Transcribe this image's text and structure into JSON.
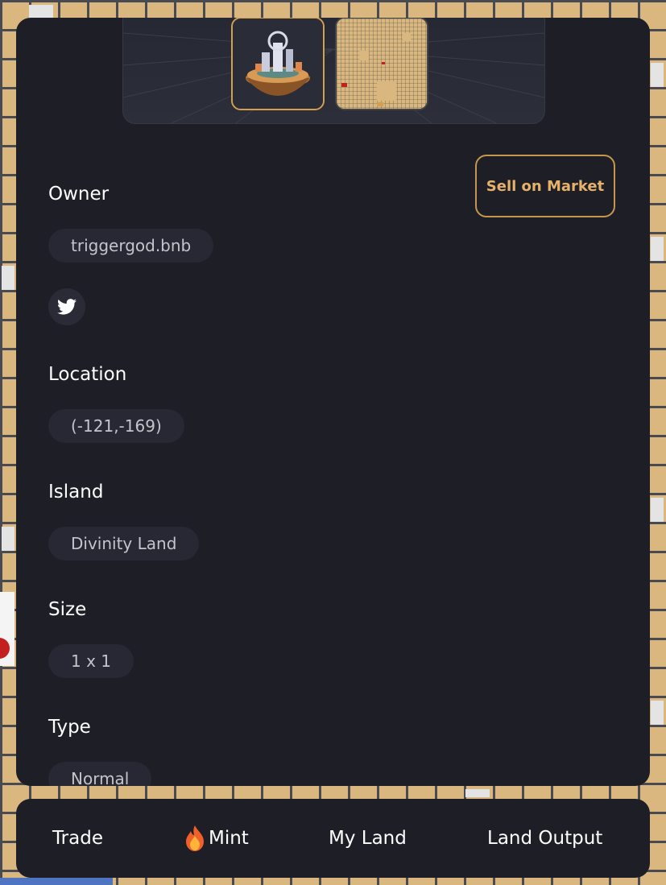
{
  "actions": {
    "sell_label": "Sell on Market"
  },
  "details": {
    "owner": {
      "label": "Owner",
      "value": "triggergod.bnb"
    },
    "location": {
      "label": "Location",
      "value": "(-121,-169)"
    },
    "island": {
      "label": "Island",
      "value": "Divinity Land"
    },
    "size": {
      "label": "Size",
      "value": "1 x 1"
    },
    "type": {
      "label": "Type",
      "value": "Normal"
    }
  },
  "social": {
    "icon": "twitter-icon"
  },
  "nav": {
    "items": [
      {
        "label": "Trade"
      },
      {
        "label": "Mint",
        "icon": "flame-icon"
      },
      {
        "label": "My Land"
      },
      {
        "label": "Land Output"
      }
    ]
  },
  "colors": {
    "panel_bg": "#1e1e27",
    "pill_bg": "#272833",
    "accent_gold": "#d3a050",
    "map_sand": "#d9b77e"
  }
}
